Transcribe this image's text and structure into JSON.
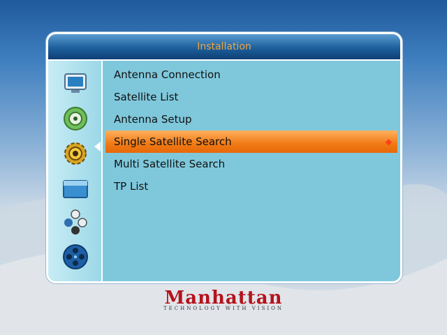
{
  "window": {
    "title": "Installation"
  },
  "sidebar": {
    "icons": [
      "tv-icon",
      "satellite-dish-icon",
      "gear-icon",
      "folder-icon",
      "games-icon",
      "film-reel-icon"
    ],
    "active_index": 1
  },
  "menu": {
    "items": [
      {
        "label": "Antenna Connection"
      },
      {
        "label": "Satellite List"
      },
      {
        "label": "Antenna Setup"
      },
      {
        "label": "Single Satellite Search",
        "selected": true
      },
      {
        "label": "Multi Satellite Search"
      },
      {
        "label": "TP List"
      }
    ]
  },
  "logo": {
    "brand": "Manhattan",
    "tagline": "TECHNOLOGY WITH VISION"
  },
  "colors": {
    "selection": "#f07a14",
    "panel": "#7fc8dc",
    "title_text": "#f0a640",
    "brand": "#b5121b"
  }
}
